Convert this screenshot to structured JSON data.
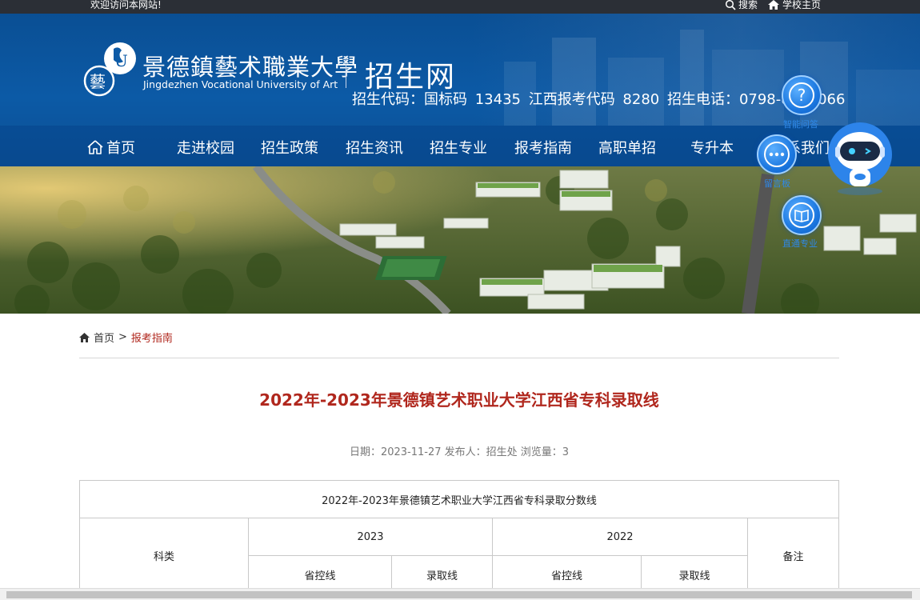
{
  "topbar": {
    "welcome": "欢迎访问本网站!",
    "search_label": "搜索",
    "home_label": "学校主页"
  },
  "header": {
    "logo_cn": "景德鎮藝术職業大學",
    "logo_en": "Jingdezhen Vocational University of Art",
    "site_name": "招生网",
    "codes": "招生代码：国标码 13435   江西报考代码 8280   招生电话：0798-8499066"
  },
  "nav": {
    "items": [
      {
        "label": "首页"
      },
      {
        "label": "走进校园"
      },
      {
        "label": "招生政策"
      },
      {
        "label": "招生资讯"
      },
      {
        "label": "招生专业"
      },
      {
        "label": "报考指南"
      },
      {
        "label": "高职单招"
      },
      {
        "label": "专升本"
      },
      {
        "label": "联系我们"
      }
    ]
  },
  "floating": {
    "qa_label": "智能问答",
    "msg_label": "留言板",
    "major_label": "直通专业"
  },
  "breadcrumb": {
    "home": "首页",
    "separator": ">",
    "current": "报考指南"
  },
  "article": {
    "title": "2022年-2023年景德镇艺术职业大学江西省专科录取线",
    "meta": "日期：2023-11-27  发布人：招生处  浏览量：3"
  },
  "table": {
    "caption": "2022年-2023年景德镇艺术职业大学江西省专科录取分数线",
    "col_subject": "科类",
    "year_a": "2023",
    "year_b": "2022",
    "col_remark": "备注",
    "sub_a1": "省控线",
    "sub_a2": "录取线",
    "sub_b1": "省控线",
    "sub_b2": "录取线"
  },
  "colors": {
    "topbar": "#2b2f36",
    "header": "#0c5aa6",
    "accent_red": "#b0271d",
    "float_blue": "#1c78e0"
  }
}
